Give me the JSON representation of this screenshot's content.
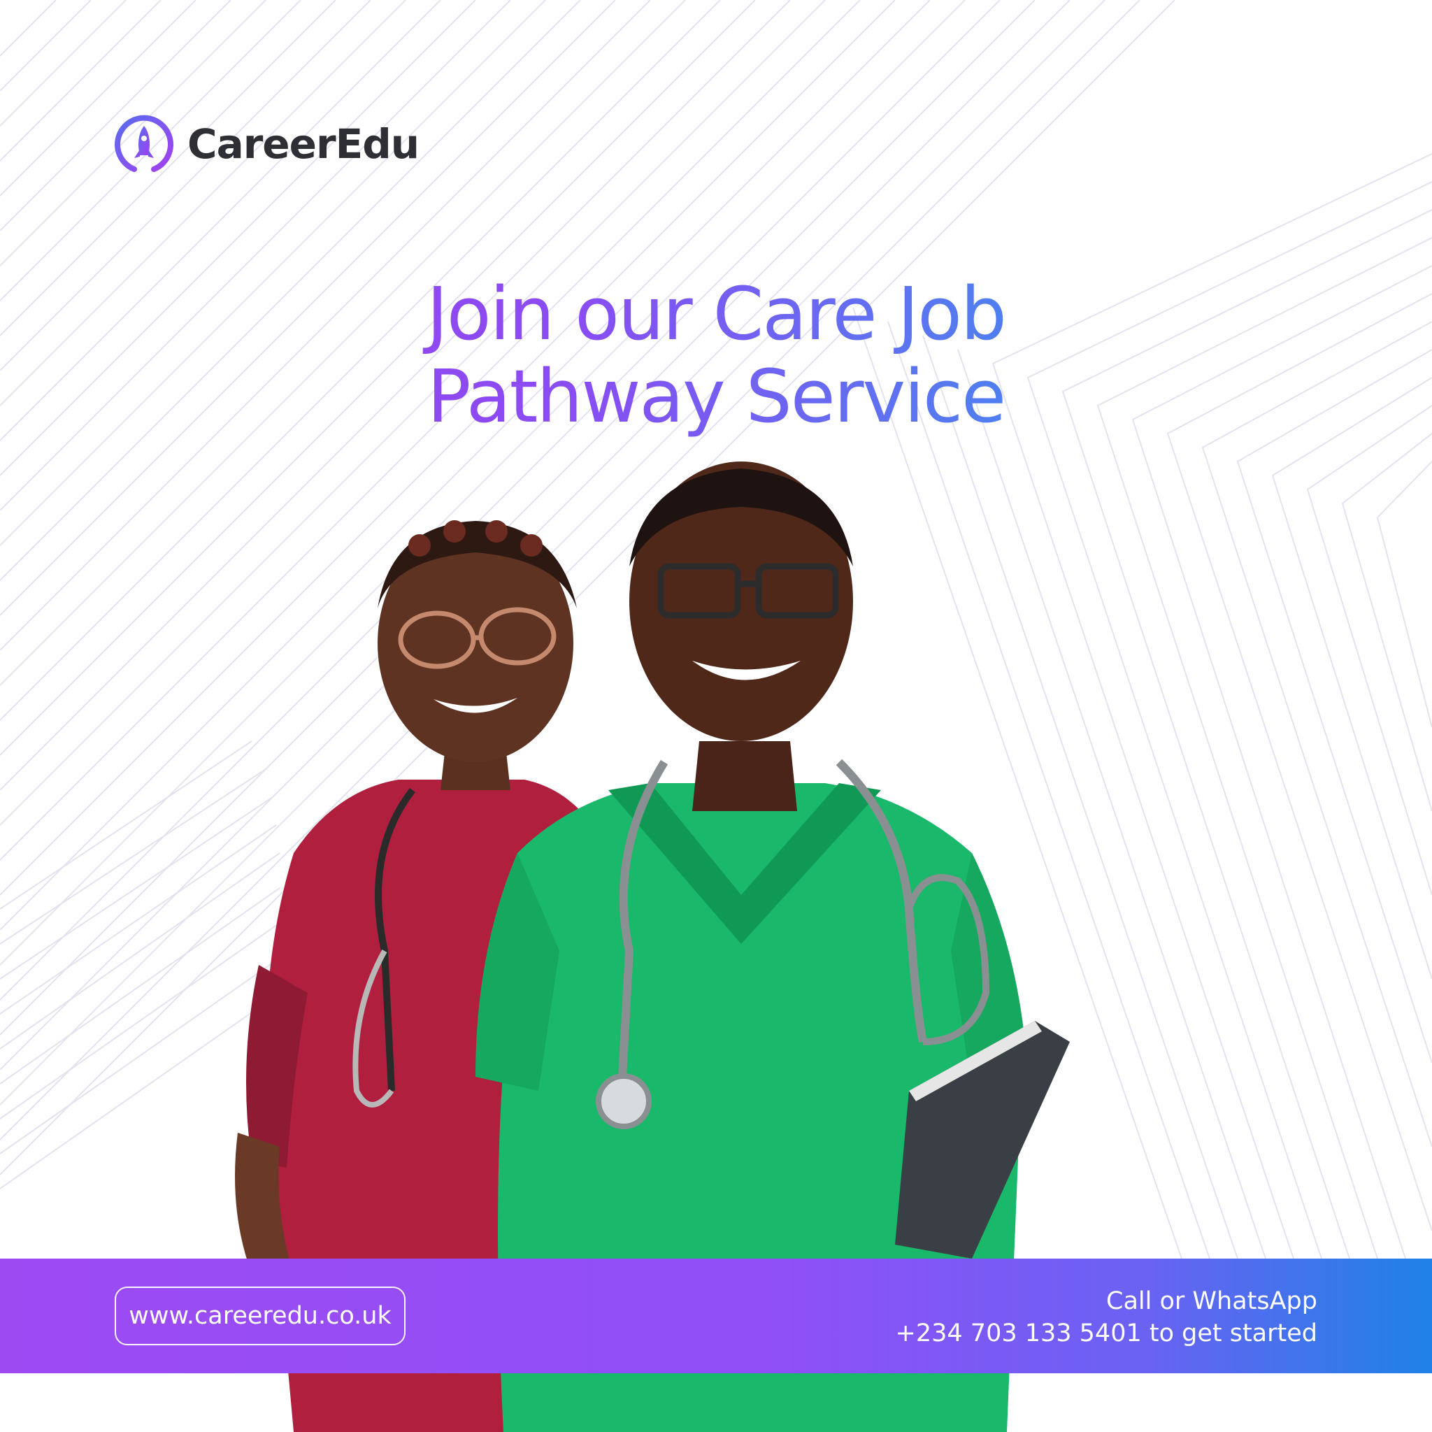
{
  "brand": {
    "name": "CareerEdu",
    "logo_icon": "rocket-ring-icon",
    "gradient_start": "#a03ff0",
    "gradient_end": "#1f86e3"
  },
  "headline": {
    "line1": "Join our Care Job",
    "line2": "Pathway Service"
  },
  "photo": {
    "icon": "two-healthcare-workers-photo"
  },
  "footer": {
    "website": "www.careeredu.co.uk",
    "contact_line1": "Call or WhatsApp",
    "contact_line2": "+234 703 133 5401 to get started",
    "band_color_start": "#9d4af3",
    "band_color_end": "#1f82e6"
  }
}
